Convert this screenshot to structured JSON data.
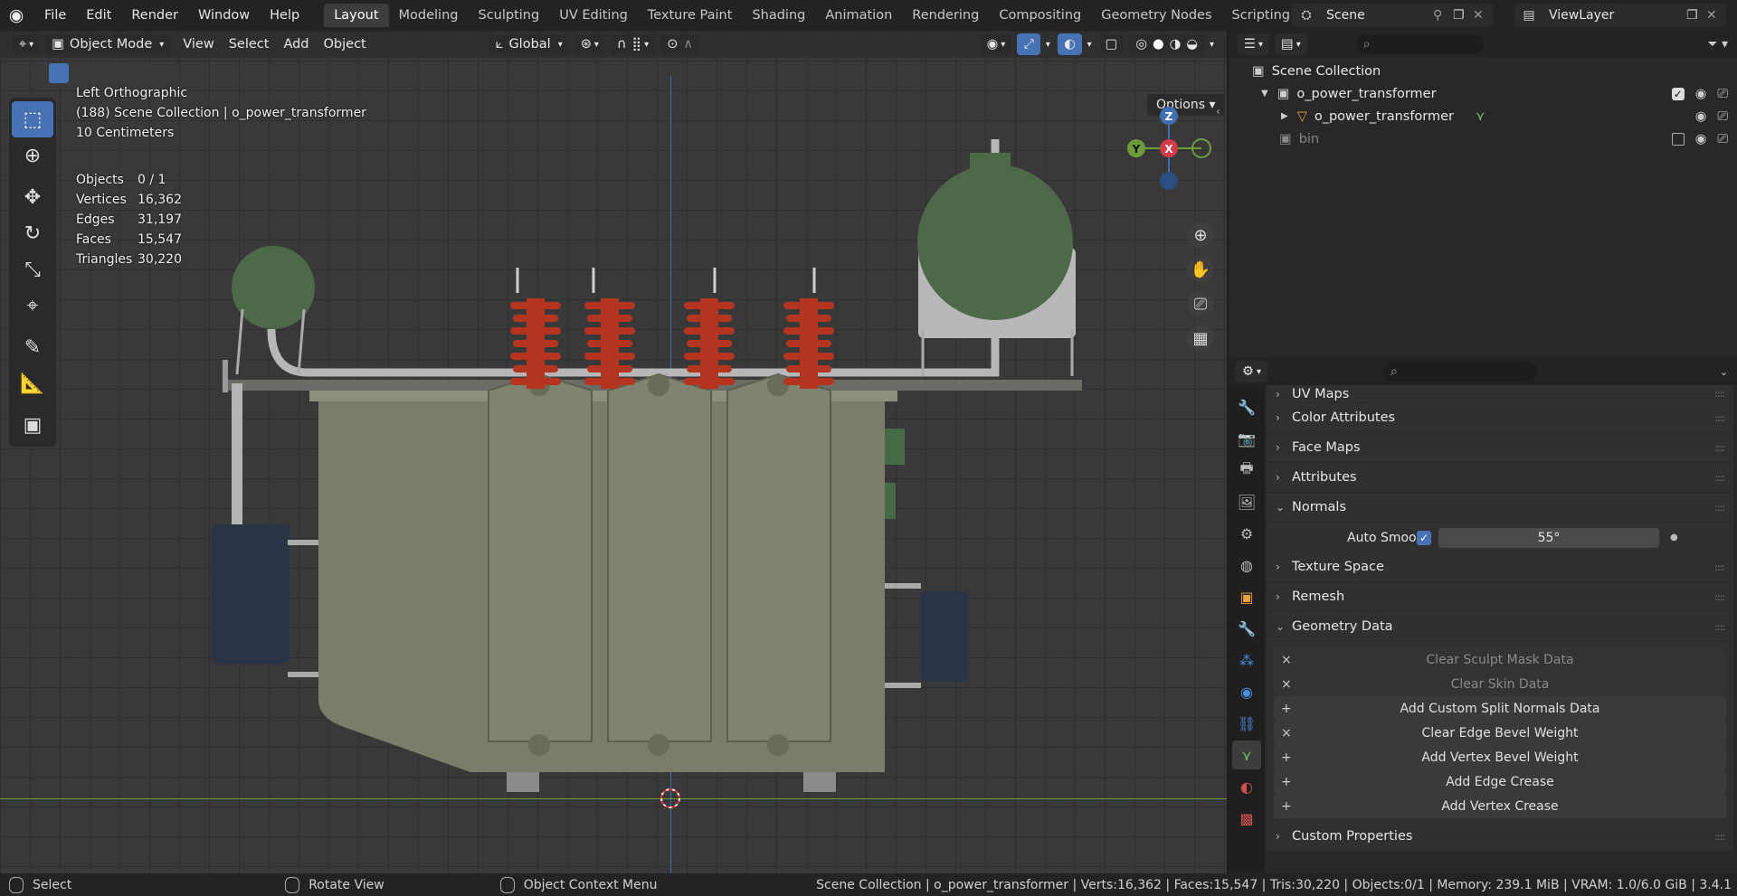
{
  "topbar": {
    "menus": [
      "File",
      "Edit",
      "Render",
      "Window",
      "Help"
    ],
    "workspaces": [
      "Layout",
      "Modeling",
      "Sculpting",
      "UV Editing",
      "Texture Paint",
      "Shading",
      "Animation",
      "Rendering",
      "Compositing",
      "Geometry Nodes",
      "Scripting"
    ],
    "active_workspace": "Layout",
    "scene": "Scene",
    "view_layer": "ViewLayer"
  },
  "viewport": {
    "mode": "Object Mode",
    "menus": [
      "View",
      "Select",
      "Add",
      "Object"
    ],
    "orientation": "Global",
    "options_label": "Options",
    "view_name": "Left Orthographic",
    "collection_line": "(188) Scene Collection | o_power_transformer",
    "scale_line": "10 Centimeters",
    "stats": [
      {
        "label": "Objects",
        "value": "0 / 1"
      },
      {
        "label": "Vertices",
        "value": "16,362"
      },
      {
        "label": "Edges",
        "value": "31,197"
      },
      {
        "label": "Faces",
        "value": "15,547"
      },
      {
        "label": "Triangles",
        "value": "30,220"
      }
    ],
    "gizmo": {
      "z": "Z",
      "y": "Y",
      "x": "X"
    }
  },
  "outliner": {
    "root": "Scene Collection",
    "items": [
      {
        "label": "o_power_transformer",
        "level": 1
      },
      {
        "label": "o_power_transformer",
        "level": 2
      },
      {
        "label": "bin",
        "level": 1
      }
    ]
  },
  "properties": {
    "panels_top": [
      "UV Maps",
      "Color Attributes",
      "Face Maps",
      "Attributes"
    ],
    "normals": {
      "title": "Normals",
      "auto_smooth_label": "Auto Smooth",
      "angle": "55°"
    },
    "panels_mid": [
      "Texture Space",
      "Remesh"
    ],
    "geometry_data": {
      "title": "Geometry Data",
      "buttons": [
        {
          "label": "Clear Sculpt Mask Data",
          "icon": "×",
          "enabled": false
        },
        {
          "label": "Clear Skin Data",
          "icon": "×",
          "enabled": false
        },
        {
          "label": "Add Custom Split Normals Data",
          "icon": "+",
          "enabled": true
        },
        {
          "label": "Clear Edge Bevel Weight",
          "icon": "×",
          "enabled": true
        },
        {
          "label": "Add Vertex Bevel Weight",
          "icon": "+",
          "enabled": true
        },
        {
          "label": "Add Edge Crease",
          "icon": "+",
          "enabled": true
        },
        {
          "label": "Add Vertex Crease",
          "icon": "+",
          "enabled": true
        }
      ]
    },
    "custom_properties": "Custom Properties"
  },
  "statusbar": {
    "select": "Select",
    "rotate": "Rotate View",
    "context": "Object Context Menu",
    "info": "Scene Collection | o_power_transformer | Verts:16,362 | Faces:15,547 | Tris:30,220 | Objects:0/1 | Memory: 239.1 MiB | VRAM: 1.0/6.0 GiB | 3.4.1"
  }
}
